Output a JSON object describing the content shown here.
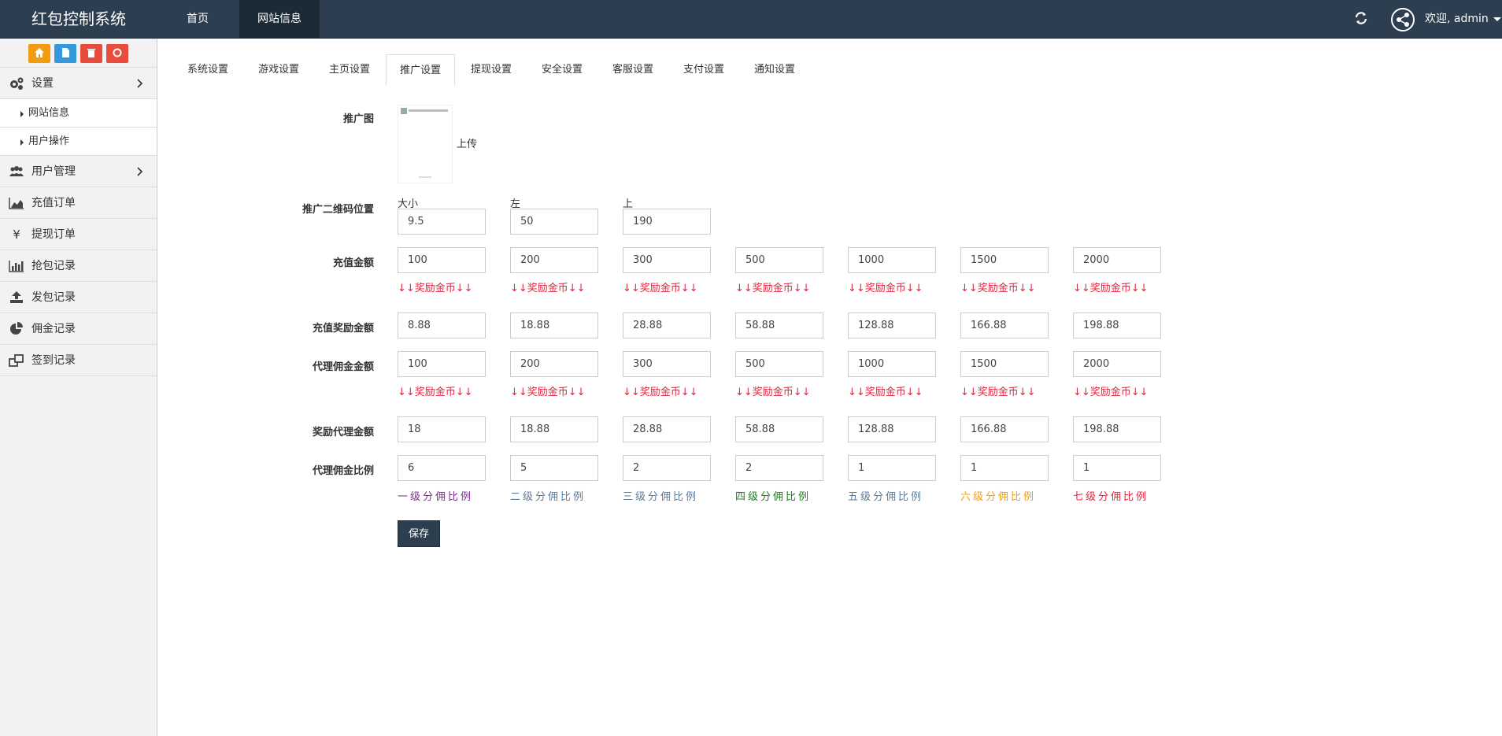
{
  "app": {
    "title": "红包控制系统"
  },
  "topnav": {
    "home": "首页",
    "site_info": "网站信息"
  },
  "user": {
    "welcome": "欢迎, admin"
  },
  "sidebar": {
    "settings": "设置",
    "sub": [
      "网站信息",
      "用户操作"
    ],
    "items": [
      "用户管理",
      "充值订单",
      "提现订单",
      "抢包记录",
      "发包记录",
      "佣金记录",
      "签到记录"
    ]
  },
  "tabs": [
    "系统设置",
    "游戏设置",
    "主页设置",
    "推广设置",
    "提现设置",
    "安全设置",
    "客服设置",
    "支付设置",
    "通知设置"
  ],
  "active_tab": "推广设置",
  "form": {
    "promo_image_label": "推广图",
    "upload_label": "上传",
    "qr_label": "推广二维码位置",
    "qr_fields": [
      {
        "label": "大小",
        "value": "9.5"
      },
      {
        "label": "左",
        "value": "50"
      },
      {
        "label": "上",
        "value": "190"
      }
    ],
    "recharge_label": "充值金额",
    "recharge": [
      "100",
      "200",
      "300",
      "500",
      "1000",
      "1500",
      "2000"
    ],
    "reward_hint": "↓↓奖励金币↓↓",
    "recharge_reward_label": "充值奖励金额",
    "recharge_reward": [
      "8.88",
      "18.88",
      "28.88",
      "58.88",
      "128.88",
      "166.88",
      "198.88"
    ],
    "agent_comm_label": "代理佣金金额",
    "agent_comm": [
      "100",
      "200",
      "300",
      "500",
      "1000",
      "1500",
      "2000"
    ],
    "agent_reward_label": "奖励代理金额",
    "agent_reward": [
      "18",
      "18.88",
      "28.88",
      "58.88",
      "128.88",
      "166.88",
      "198.88"
    ],
    "ratio_label": "代理佣金比例",
    "ratio": [
      "6",
      "5",
      "2",
      "2",
      "1",
      "1",
      "1"
    ],
    "levels": [
      "一级分佣比例",
      "二级分佣比例",
      "三级分佣比例",
      "四级分佣比例",
      "五级分佣比例",
      "六级分佣比例",
      "七级分佣比例"
    ],
    "level_colors": [
      "#7b2d8e",
      "#5b7a99",
      "#5b7a99",
      "#1e7b1e",
      "#5b7a99",
      "#f39c12",
      "#e5233d"
    ],
    "save": "保存"
  },
  "colors": {
    "topbar": "#2c3e50",
    "hint": "#e5233d",
    "quick_orange": "#f39c12",
    "quick_blue": "#3498db",
    "quick_red": "#e74c3c"
  }
}
